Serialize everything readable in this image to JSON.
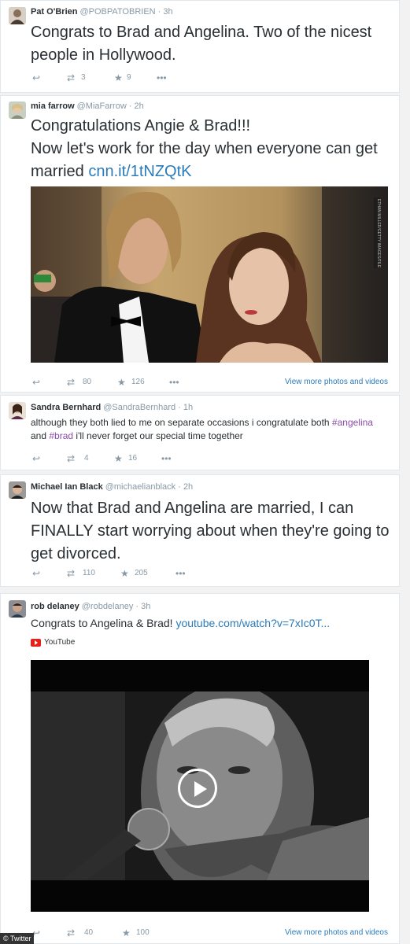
{
  "tweets": [
    {
      "name": "Pat O'Brien",
      "handle": "@POBPATOBRIEN",
      "time": "· 3h",
      "text": "Congrats to Brad and Angelina.  Two of the nicest people in Hollywood.",
      "retweets": "3",
      "favorites": "9"
    },
    {
      "name": "mia farrow",
      "handle": "@MiaFarrow",
      "time": "· 2h",
      "text_line1": "Congratulations Angie & Brad!!!",
      "text_line2": "Now let's work for the day when everyone can get married ",
      "link": "cnn.it/1tNZQtK",
      "retweets": "80",
      "favorites": "126",
      "more": "View more photos and videos",
      "photo_credit": "ETHAN MILLER/GETTY IMAGES/FILE"
    },
    {
      "name": "Sandra Bernhard",
      "handle": "@SandraBernhard",
      "time": "· 1h",
      "text_a": "although they both lied to me on separate occasions  i congratulate both ",
      "tag1": "#angelina",
      "text_b": " and ",
      "tag2": "#brad",
      "text_c": " i'll never forget our special time together",
      "retweets": "4",
      "favorites": "16"
    },
    {
      "name": "Michael Ian Black",
      "handle": "@michaelianblack",
      "time": "· 2h",
      "text": "Now that Brad and Angelina are married, I can FINALLY start worrying about when they're going to get divorced.",
      "retweets": "110",
      "favorites": "205"
    },
    {
      "name": "rob delaney",
      "handle": "@robdelaney",
      "time": "· 3h",
      "text": "Congrats to Angelina & Brad! ",
      "link": "youtube.com/watch?v=7xIc0T...",
      "source": "YouTube",
      "retweets": "40",
      "favorites": "100",
      "more": "View more photos and videos"
    }
  ],
  "icons": {
    "reply": "reply-icon",
    "retweet": "retweet-icon",
    "favorite": "star-icon",
    "more": "ellipsis-icon",
    "play": "play-icon"
  },
  "footer": {
    "credit": "© Twitter"
  },
  "colors": {
    "link": "#2b7bb9",
    "muted": "#8899a6",
    "youtube": "#e62117"
  }
}
